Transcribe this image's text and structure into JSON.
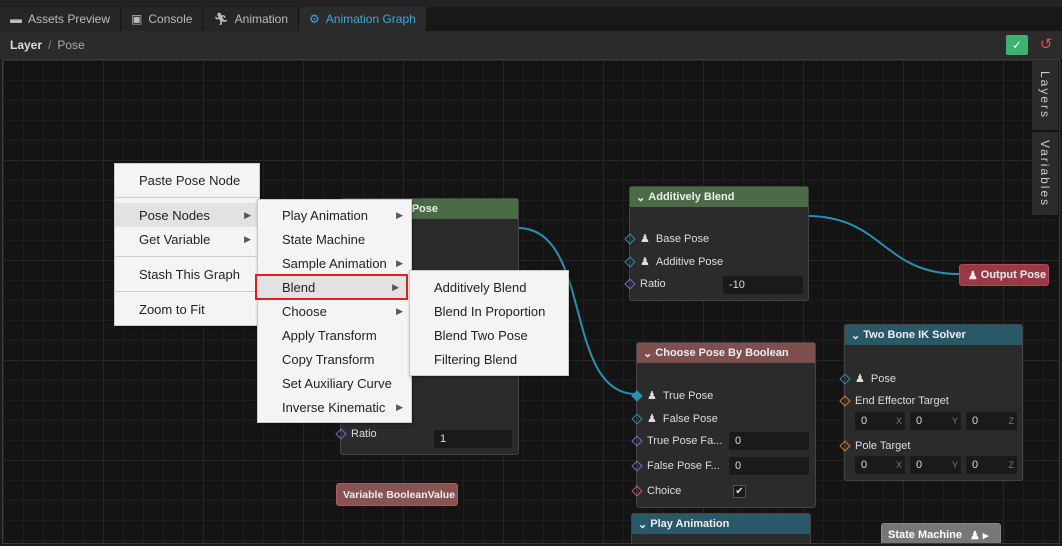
{
  "tabs": [
    {
      "label": "Assets Preview",
      "icon": "folder-icon"
    },
    {
      "label": "Console",
      "icon": "terminal-icon"
    },
    {
      "label": "Animation",
      "icon": "running-icon"
    },
    {
      "label": "Animation Graph",
      "icon": "graph-icon",
      "active": true
    }
  ],
  "breadcrumb": {
    "root": "Layer",
    "sep": "/",
    "current": "Pose"
  },
  "side_tabs": [
    "Layers",
    "Variables"
  ],
  "nodes": {
    "hidden_pose": {
      "title": "Pose",
      "ratio_label": "Ratio",
      "ratio_value": "1",
      "color": "#4b6b47"
    },
    "additively_blend": {
      "title": "Additively Blend",
      "base": "Base Pose",
      "additive": "Additive Pose",
      "ratio_label": "Ratio",
      "ratio_value": "-10",
      "color": "#4b6b47"
    },
    "output_pose": {
      "title": "Output Pose",
      "color": "#9b3848"
    },
    "choose_pose": {
      "title": "Choose Pose By Boolean",
      "true_pose": "True Pose",
      "false_pose": "False Pose",
      "true_fade": "True Pose Fa...",
      "true_fade_value": "0",
      "false_fade": "False Pose F...",
      "false_fade_value": "0",
      "choice": "Choice",
      "choice_checked": true,
      "color": "#7d4f4f"
    },
    "two_bone": {
      "title": "Two Bone IK Solver",
      "pose": "Pose",
      "end_effector": "End Effector Target",
      "pole": "Pole Target",
      "ee": [
        "0",
        "0",
        "0"
      ],
      "pt": [
        "0",
        "0",
        "0"
      ],
      "axes": [
        "X",
        "Y",
        "Z"
      ],
      "color": "#295868"
    },
    "play_animation": {
      "title": "Play Animation",
      "color": "#295868"
    },
    "state_machine": {
      "title": "State Machine"
    },
    "variable_bool": {
      "title": "Variable BooleanValue"
    }
  },
  "context_menu": {
    "items": [
      "Paste Pose Node",
      "Pose Nodes",
      "Get Variable",
      "Stash This Graph",
      "Zoom to Fit"
    ]
  },
  "pose_nodes_menu": {
    "items": [
      "Play Animation",
      "State Machine",
      "Sample Animation",
      "Blend",
      "Choose",
      "Apply Transform",
      "Copy Transform",
      "Set Auxiliary Curve",
      "Inverse Kinematic"
    ]
  },
  "blend_menu": {
    "items": [
      "Additively Blend",
      "Blend In Proportion",
      "Blend Two Pose",
      "Filtering Blend"
    ]
  }
}
